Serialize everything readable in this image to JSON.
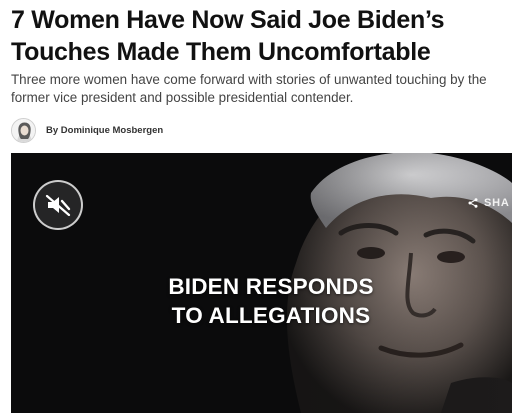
{
  "article": {
    "headline": "7 Women Have Now Said Joe Biden’s Touches Made Them Uncomfortable",
    "subheadline": "Three more women have come forward with stories of unwanted touching by the former vice president and possible presidential contender.",
    "byline": "By Dominique Mosbergen"
  },
  "video": {
    "overlay_line1": "BIDEN RESPONDS",
    "overlay_line2": "TO ALLEGATIONS",
    "share_label": "SHA",
    "mute_icon": "speaker-muted-icon",
    "share_icon": "share-icon"
  }
}
